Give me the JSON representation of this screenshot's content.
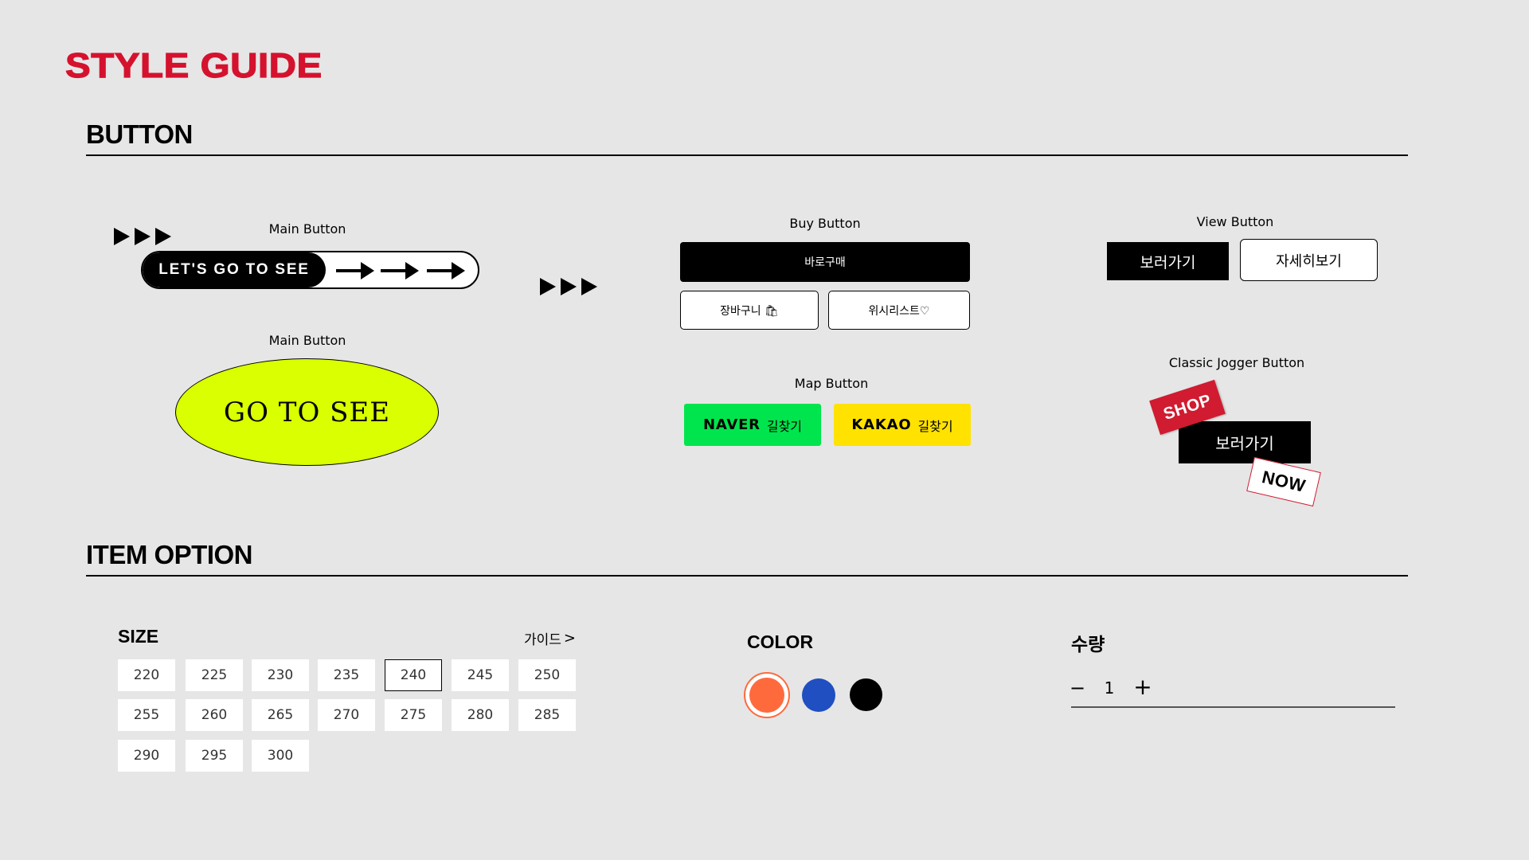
{
  "title": "STYLE GUIDE",
  "sections": {
    "button": "BUTTON",
    "item_option": "ITEM OPTION"
  },
  "main_button": {
    "caption_pill": "Main Button",
    "pill_label": "LET'S GO TO SEE",
    "caption_ellipse": "Main Button",
    "ellipse_label": "GO TO SEE"
  },
  "buy_button": {
    "caption": "Buy Button",
    "buy_now": "바로구매",
    "cart": "장바구니 🛍",
    "wishlist": "위시리스트♡"
  },
  "map_button": {
    "caption": "Map Button",
    "naver": "NAVER",
    "kakao": "KAKAO",
    "directions": "길찾기",
    "naver_color": "#00e54d",
    "kakao_color": "#ffe200"
  },
  "view_button": {
    "caption": "View Button",
    "view": "보러가기",
    "details": "자세히보기"
  },
  "jogger_button": {
    "caption": "Classic Jogger Button",
    "label": "보러가기",
    "sticker_shop": "SHOP",
    "sticker_now": "NOW"
  },
  "size": {
    "label": "SIZE",
    "guide": "가이드",
    "selected": "240",
    "options": [
      "220",
      "225",
      "230",
      "235",
      "240",
      "245",
      "250",
      "255",
      "260",
      "265",
      "270",
      "275",
      "280",
      "285",
      "290",
      "295",
      "300"
    ]
  },
  "color": {
    "label": "COLOR",
    "swatches": [
      "#ff6a3d",
      "#1f4fc1",
      "#000000"
    ],
    "selected": "#ff6a3d"
  },
  "quantity": {
    "label": "수량",
    "minus": "−",
    "value": "1",
    "plus": "+"
  },
  "accent_color": "#d5122e"
}
